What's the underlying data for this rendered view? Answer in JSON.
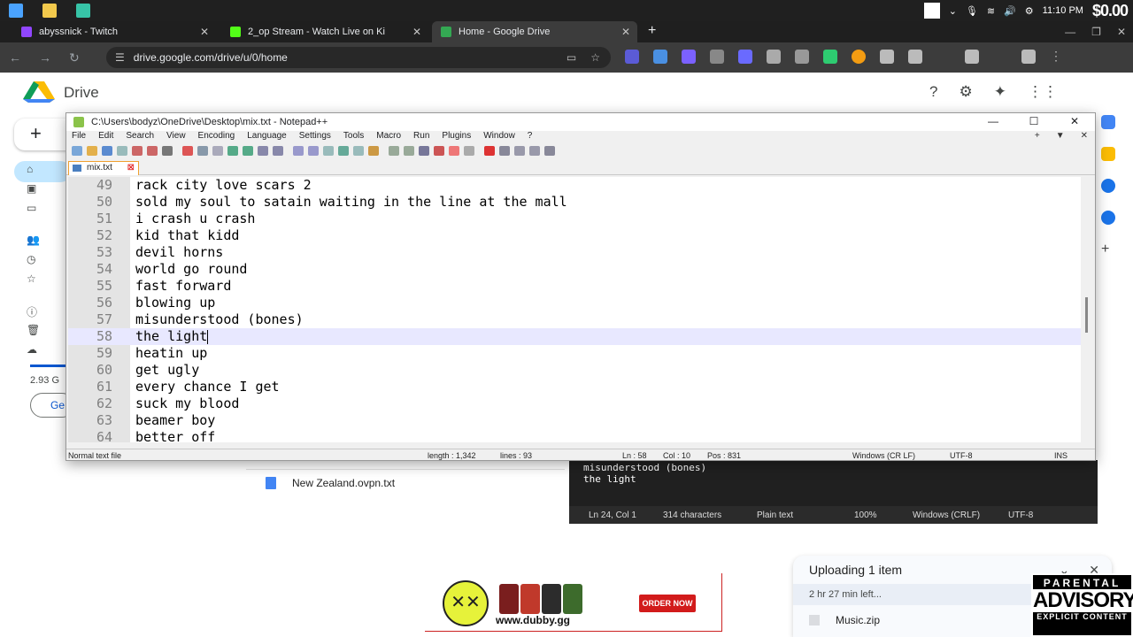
{
  "taskbar": {
    "time": "11:10 PM",
    "overlay_money": "$0.00"
  },
  "browser": {
    "tabs": [
      {
        "label": "abyssnick - Twitch",
        "color": "#9146ff"
      },
      {
        "label": "2_op Stream - Watch Live on Ki",
        "color": "#53fc18"
      },
      {
        "label": "Home - Google Drive",
        "color": "#34a853"
      }
    ],
    "new_tab": "+",
    "url": "drive.google.com/drive/u/0/home"
  },
  "drive": {
    "app_title": "Drive",
    "new_button": "+",
    "sidebar": [
      "Home",
      "My Drive",
      "Computers",
      "Shared",
      "Recent",
      "Starred",
      "Spam",
      "Trash",
      "Storage"
    ],
    "storage_used": "2.93 G",
    "get_storage_label": "Ge",
    "file_row": "New Zealand.ovpn.txt",
    "accent": "#0b57d0"
  },
  "notepad": {
    "title": "C:\\Users\\bodyz\\OneDrive\\Desktop\\mix.txt - Notepad++",
    "menu": [
      "File",
      "Edit",
      "Search",
      "View",
      "Encoding",
      "Language",
      "Settings",
      "Tools",
      "Macro",
      "Run",
      "Plugins",
      "Window",
      "?"
    ],
    "menu_right": [
      "+",
      "▼",
      "✕"
    ],
    "tab_label": "mix.txt",
    "lines": [
      {
        "n": "49",
        "text": "rack city love scars 2"
      },
      {
        "n": "50",
        "text": "sold my soul to satain waiting in the line at the mall"
      },
      {
        "n": "51",
        "text": "i crash u crash"
      },
      {
        "n": "52",
        "text": "kid that kidd"
      },
      {
        "n": "53",
        "text": "devil horns"
      },
      {
        "n": "54",
        "text": "world go round"
      },
      {
        "n": "55",
        "text": "fast forward"
      },
      {
        "n": "56",
        "text": "blowing up"
      },
      {
        "n": "57",
        "text": "misunderstood (bones)"
      },
      {
        "n": "58",
        "text": "the light"
      },
      {
        "n": "59",
        "text": "heatin up"
      },
      {
        "n": "60",
        "text": "get ugly"
      },
      {
        "n": "61",
        "text": "every chance I get"
      },
      {
        "n": "62",
        "text": "suck my blood"
      },
      {
        "n": "63",
        "text": "beamer boy"
      },
      {
        "n": "64",
        "text": "better off"
      }
    ],
    "current_line": "58",
    "status": {
      "type": "Normal text file",
      "length": "length : 1,342",
      "lines": "lines : 93",
      "ln": "Ln : 58",
      "col": "Col : 10",
      "pos": "Pos : 831",
      "eol": "Windows (CR LF)",
      "encoding": "UTF-8",
      "mode": "INS"
    }
  },
  "notepad2": {
    "text_lines": [
      "misunderstood (bones)",
      "the light"
    ],
    "status": [
      "Ln 24, Col 1",
      "314 characters",
      "Plain text",
      "100%",
      "Windows (CRLF)",
      "UTF-8"
    ]
  },
  "upload": {
    "title": "Uploading 1 item",
    "time_left": "2 hr 27 min left...",
    "file": "Music.zip"
  },
  "ad": {
    "url": "www.dubby.gg",
    "button": "ORDER NOW"
  },
  "parental_advisory": {
    "line1": "PARENTAL",
    "line2": "ADVISORY",
    "line3": "EXPLICIT CONTENT"
  }
}
